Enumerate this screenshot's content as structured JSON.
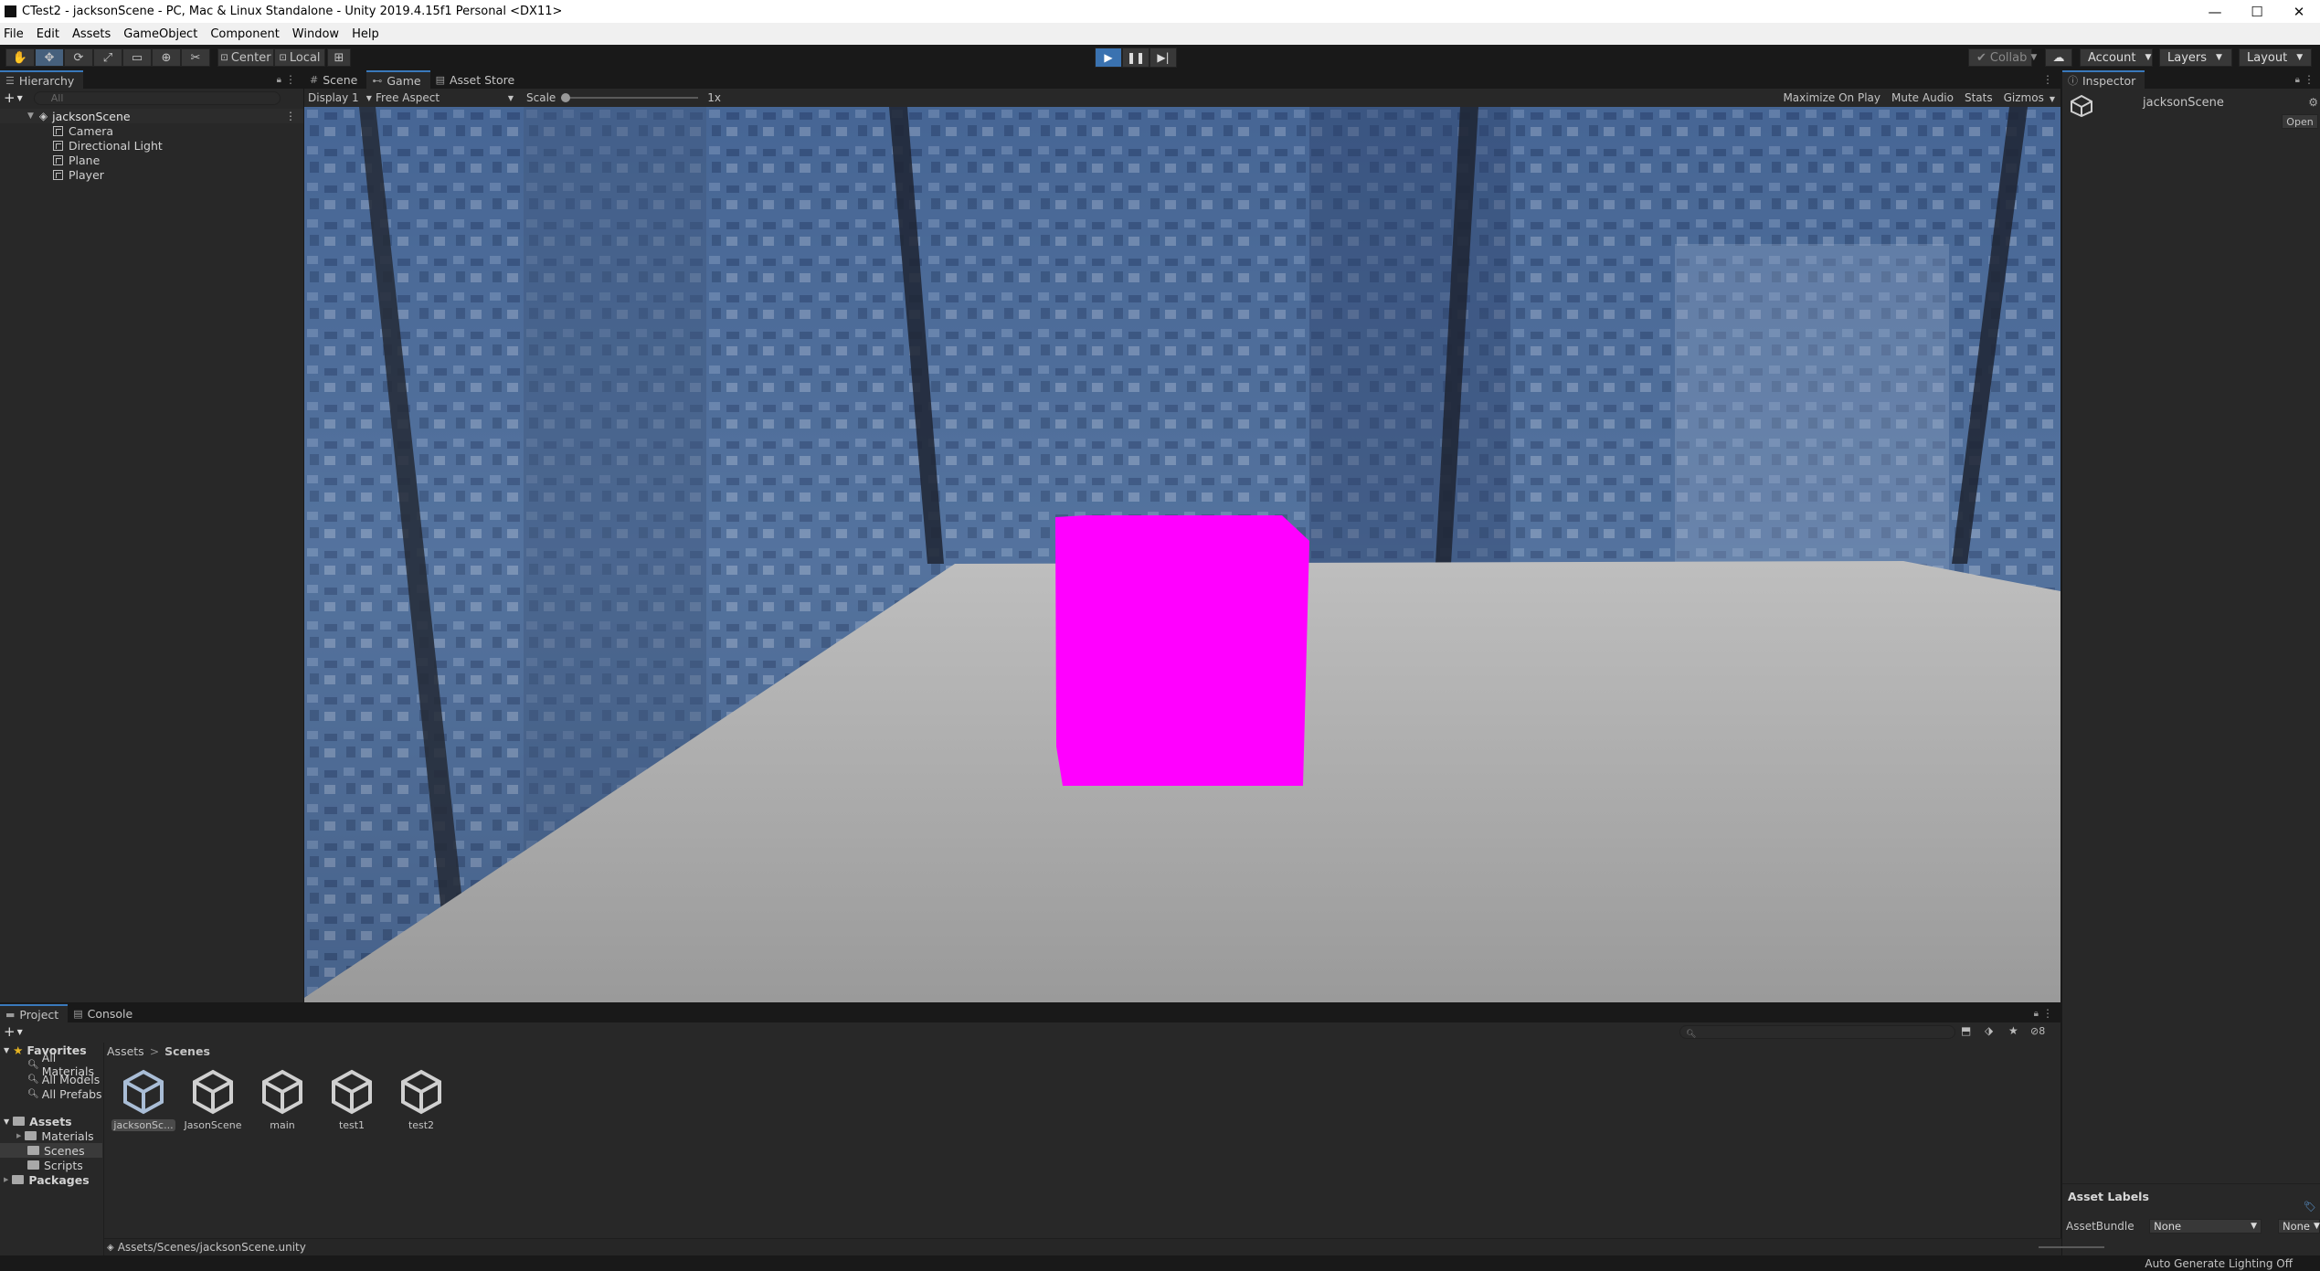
{
  "window": {
    "title": "CTest2 - jacksonScene - PC, Mac & Linux Standalone - Unity 2019.4.15f1 Personal <DX11>",
    "minimize": "—",
    "maximize": "☐",
    "close": "✕"
  },
  "menu": [
    "File",
    "Edit",
    "Assets",
    "GameObject",
    "Component",
    "Window",
    "Help"
  ],
  "toolbar": {
    "pivot": "Center",
    "space": "Local",
    "collab": "Collab",
    "account": "Account",
    "layers": "Layers",
    "layout": "Layout",
    "play_active": true,
    "accent": "#3a72b0"
  },
  "hierarchy": {
    "tab": "Hierarchy",
    "search_placeholder": "All",
    "scene": "jacksonScene",
    "items": [
      "Camera",
      "Directional Light",
      "Plane",
      "Player"
    ]
  },
  "center_tabs": [
    "Scene",
    "Game",
    "Asset Store"
  ],
  "game": {
    "display": "Display 1",
    "aspect": "Free Aspect",
    "scale_label": "Scale",
    "scale_value": "1x",
    "maximize": "Maximize On Play",
    "mute": "Mute Audio",
    "stats": "Stats",
    "gizmos": "Gizmos",
    "cube_color": "#ff00ff",
    "plane_color": "#a9a9a9"
  },
  "inspector": {
    "tab": "Inspector",
    "object_name": "jacksonScene",
    "open_button": "Open",
    "asset_labels": "Asset Labels",
    "assetbundle_label": "AssetBundle",
    "assetbundle_value": "None",
    "variant_value": "None"
  },
  "project": {
    "tabs": [
      "Project",
      "Console"
    ],
    "favorites": "Favorites",
    "fav_items": [
      "All Materials",
      "All Models",
      "All Prefabs"
    ],
    "assets_root": "Assets",
    "asset_folders": [
      "Materials",
      "Scenes",
      "Scripts"
    ],
    "packages": "Packages",
    "breadcrumb_root": "Assets",
    "breadcrumb_sep": ">",
    "breadcrumb_current": "Scenes",
    "files": [
      "jacksonSc...",
      "JasonScene",
      "main",
      "test1",
      "test2"
    ],
    "selected_path": "Assets/Scenes/jacksonScene.unity",
    "hidden_count": "8"
  },
  "status": {
    "right": "Auto Generate Lighting Off"
  }
}
